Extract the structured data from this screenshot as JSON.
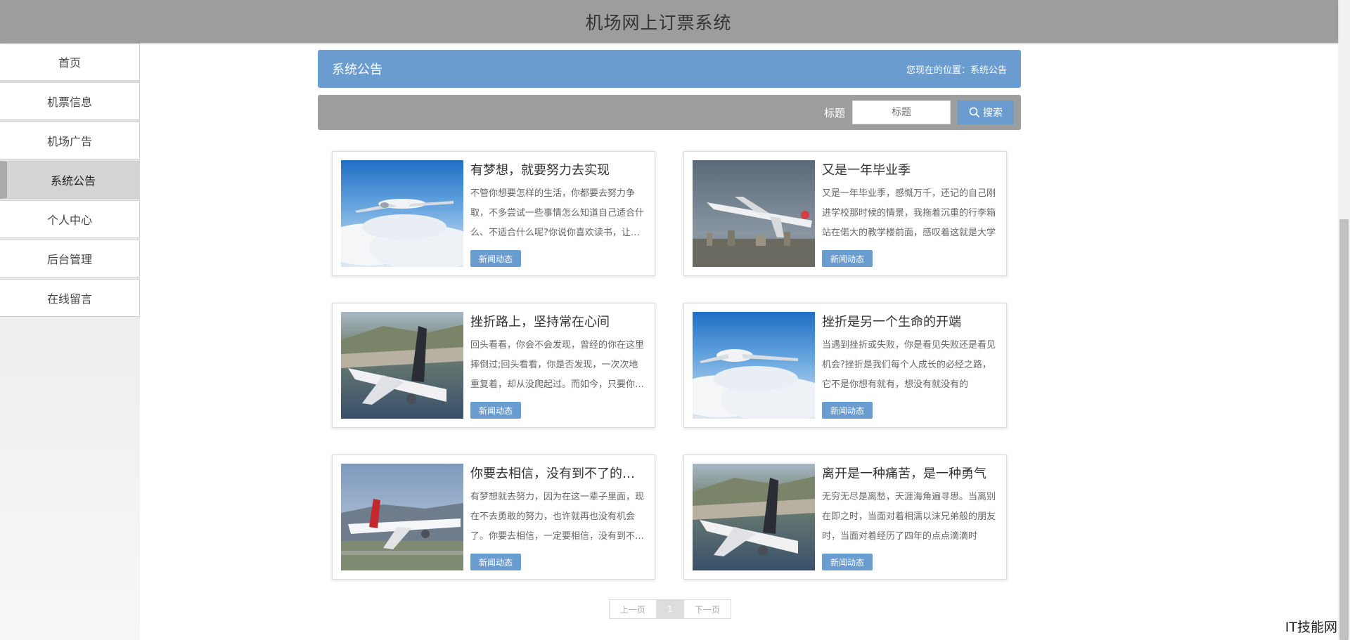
{
  "header": {
    "title": "机场网上订票系统"
  },
  "sidebar": {
    "items": [
      {
        "label": "首页",
        "active": false
      },
      {
        "label": "机票信息",
        "active": false
      },
      {
        "label": "机场广告",
        "active": false
      },
      {
        "label": "系统公告",
        "active": true
      },
      {
        "label": "个人中心",
        "active": false
      },
      {
        "label": "后台管理",
        "active": false
      },
      {
        "label": "在线留言",
        "active": false
      }
    ]
  },
  "panel": {
    "title": "系统公告",
    "location": "您现在的位置：系统公告"
  },
  "search": {
    "label": "标题",
    "placeholder": "标题",
    "button": "搜索"
  },
  "cards": [
    {
      "title": "有梦想，就要努力去实现",
      "desc": "不管你想要怎样的生活，你都要去努力争取，不多尝试一些事情怎么知道自己适合什么、不适合什么呢?你说你喜欢读书，让我给你列书单，你还问我哪里有那么多时间读书",
      "tag": "新闻动态",
      "image": "plane-clouds"
    },
    {
      "title": "又是一年毕业季",
      "desc": "又是一年毕业季，感慨万千，还记的自己刚进学校那时候的情景，我拖着沉重的行李箱站在偌大的教学楼前面，感叹着这就是大学",
      "tag": "新闻动态",
      "image": "plane-takeoff-city"
    },
    {
      "title": "挫折路上，坚持常在心间",
      "desc": "回头看看，你会不会发现，曾经的你在这里摔倒过;回头看看，你是否发现，一次次地重复着，却从没爬起过。而如今，只要你的心中还有梦想",
      "tag": "新闻动态",
      "image": "plane-coast"
    },
    {
      "title": "挫折是另一个生命的开端",
      "desc": "当遇到挫折或失败，你是看见失败还是看见机会?挫折是我们每个人成长的必经之路，它不是你想有就有，想没有就没有的",
      "tag": "新闻动态",
      "image": "plane-clouds"
    },
    {
      "title": "你要去相信，没有到不了的明天",
      "desc": "有梦想就去努力，因为在这一辈子里面，现在不去勇敢的努力，也许就再也没有机会了。你要去相信，一定要相信，没有到不了的明天",
      "tag": "新闻动态",
      "image": "plane-runway"
    },
    {
      "title": "离开是一种痛苦，是一种勇气",
      "desc": "无穷无尽是离愁，天涯海角遍寻思。当离别在即之时，当面对着相濡以沫兄弟般的朋友时，当面对着经历了四年的点点滴滴时",
      "tag": "新闻动态",
      "image": "plane-coast"
    }
  ],
  "pager": {
    "prev": "上一页",
    "current": "1",
    "next": "下一页"
  },
  "watermark": "IT技能网"
}
